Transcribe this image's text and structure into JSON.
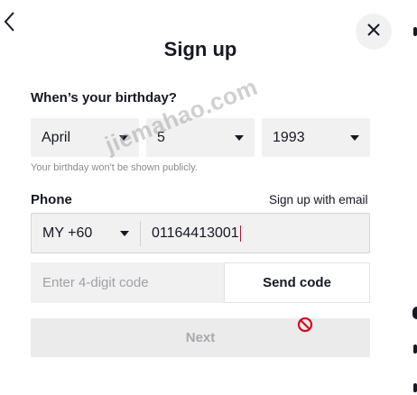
{
  "header": {
    "back_icon": "chevron-left-icon",
    "close_icon": "close-icon",
    "title": "Sign up"
  },
  "birthday": {
    "label": "When’s your birthday?",
    "month": "April",
    "day": "5",
    "year": "1993",
    "hint": "Your birthday won't be shown publicly."
  },
  "phone": {
    "label": "Phone",
    "switch_link": "Sign up with email",
    "country_code": "MY +60",
    "number": "01164413001"
  },
  "code": {
    "placeholder": "Enter 4-digit code",
    "send_label": "Send code"
  },
  "next_label": "Next",
  "cursor_icon": "forbidden-icon",
  "watermark": "jiemahao.com",
  "colors": {
    "field_bg": "#f1f1f2",
    "text": "#161823",
    "disabled_text": "#a8a9ad",
    "forbidden": "#d0101e"
  }
}
